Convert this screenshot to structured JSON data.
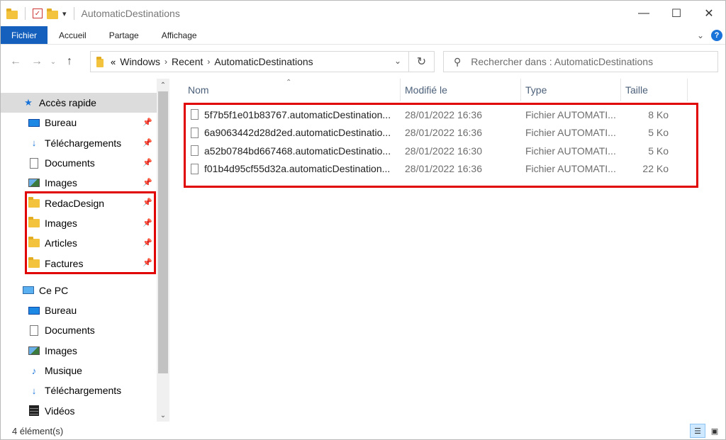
{
  "window": {
    "title": "AutomaticDestinations",
    "quick_access_overflow": "▾",
    "minimize": "—",
    "maximize": "☐",
    "close": "✕"
  },
  "ribbon": {
    "tabs": [
      "Fichier",
      "Accueil",
      "Partage",
      "Affichage"
    ],
    "help": "?"
  },
  "address": {
    "overflow": "«",
    "crumbs": [
      "Windows",
      "Recent",
      "AutomaticDestinations"
    ],
    "search_placeholder": "Rechercher dans : AutomaticDestinations"
  },
  "nav": {
    "quick_access": "Accès rapide",
    "quick_items": [
      {
        "label": "Bureau",
        "icon": "desktop-icon",
        "pinned": true
      },
      {
        "label": "Téléchargements",
        "icon": "download-icon",
        "pinned": true
      },
      {
        "label": "Documents",
        "icon": "document-icon",
        "pinned": true
      },
      {
        "label": "Images",
        "icon": "image-icon",
        "pinned": true
      },
      {
        "label": "RedacDesign",
        "icon": "folder-icon",
        "pinned": true
      },
      {
        "label": "Images",
        "icon": "folder-icon",
        "pinned": true
      },
      {
        "label": "Articles",
        "icon": "folder-icon",
        "pinned": true
      },
      {
        "label": "Factures",
        "icon": "folder-icon",
        "pinned": true
      }
    ],
    "this_pc": "Ce PC",
    "pc_items": [
      {
        "label": "Bureau",
        "icon": "desktop-icon"
      },
      {
        "label": "Documents",
        "icon": "document-icon"
      },
      {
        "label": "Images",
        "icon": "image-icon"
      },
      {
        "label": "Musique",
        "icon": "music-icon"
      },
      {
        "label": "Téléchargements",
        "icon": "download-icon"
      },
      {
        "label": "Vidéos",
        "icon": "video-icon"
      }
    ]
  },
  "columns": {
    "name": "Nom",
    "modified": "Modifié le",
    "type": "Type",
    "size": "Taille"
  },
  "files": [
    {
      "name": "5f7b5f1e01b83767.automaticDestination...",
      "modified": "28/01/2022 16:36",
      "type": "Fichier AUTOMATI...",
      "size": "8 Ko"
    },
    {
      "name": "6a9063442d28d2ed.automaticDestinatio...",
      "modified": "28/01/2022 16:36",
      "type": "Fichier AUTOMATI...",
      "size": "5 Ko"
    },
    {
      "name": "a52b0784bd667468.automaticDestinatio...",
      "modified": "28/01/2022 16:30",
      "type": "Fichier AUTOMATI...",
      "size": "5 Ko"
    },
    {
      "name": "f01b4d95cf55d32a.automaticDestination...",
      "modified": "28/01/2022 16:36",
      "type": "Fichier AUTOMATI...",
      "size": "22 Ko"
    }
  ],
  "status": {
    "count": "4 élément(s)"
  },
  "colors": {
    "highlight_box": "#e00000",
    "file_tab": "#1560bd"
  }
}
